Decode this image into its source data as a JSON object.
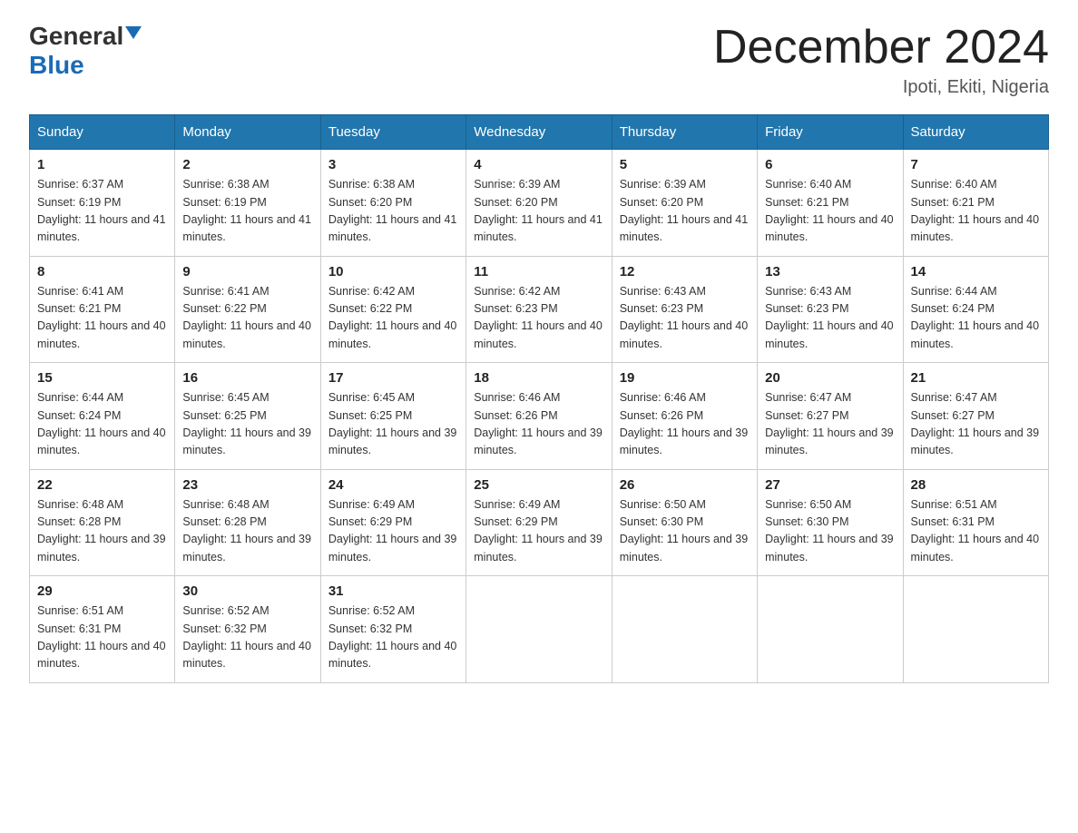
{
  "header": {
    "logo_general": "General",
    "logo_blue": "Blue",
    "month_title": "December 2024",
    "location": "Ipoti, Ekiti, Nigeria"
  },
  "days_of_week": [
    "Sunday",
    "Monday",
    "Tuesday",
    "Wednesday",
    "Thursday",
    "Friday",
    "Saturday"
  ],
  "weeks": [
    [
      {
        "day": "1",
        "sunrise": "6:37 AM",
        "sunset": "6:19 PM",
        "daylight": "11 hours and 41 minutes."
      },
      {
        "day": "2",
        "sunrise": "6:38 AM",
        "sunset": "6:19 PM",
        "daylight": "11 hours and 41 minutes."
      },
      {
        "day": "3",
        "sunrise": "6:38 AM",
        "sunset": "6:20 PM",
        "daylight": "11 hours and 41 minutes."
      },
      {
        "day": "4",
        "sunrise": "6:39 AM",
        "sunset": "6:20 PM",
        "daylight": "11 hours and 41 minutes."
      },
      {
        "day": "5",
        "sunrise": "6:39 AM",
        "sunset": "6:20 PM",
        "daylight": "11 hours and 41 minutes."
      },
      {
        "day": "6",
        "sunrise": "6:40 AM",
        "sunset": "6:21 PM",
        "daylight": "11 hours and 40 minutes."
      },
      {
        "day": "7",
        "sunrise": "6:40 AM",
        "sunset": "6:21 PM",
        "daylight": "11 hours and 40 minutes."
      }
    ],
    [
      {
        "day": "8",
        "sunrise": "6:41 AM",
        "sunset": "6:21 PM",
        "daylight": "11 hours and 40 minutes."
      },
      {
        "day": "9",
        "sunrise": "6:41 AM",
        "sunset": "6:22 PM",
        "daylight": "11 hours and 40 minutes."
      },
      {
        "day": "10",
        "sunrise": "6:42 AM",
        "sunset": "6:22 PM",
        "daylight": "11 hours and 40 minutes."
      },
      {
        "day": "11",
        "sunrise": "6:42 AM",
        "sunset": "6:23 PM",
        "daylight": "11 hours and 40 minutes."
      },
      {
        "day": "12",
        "sunrise": "6:43 AM",
        "sunset": "6:23 PM",
        "daylight": "11 hours and 40 minutes."
      },
      {
        "day": "13",
        "sunrise": "6:43 AM",
        "sunset": "6:23 PM",
        "daylight": "11 hours and 40 minutes."
      },
      {
        "day": "14",
        "sunrise": "6:44 AM",
        "sunset": "6:24 PM",
        "daylight": "11 hours and 40 minutes."
      }
    ],
    [
      {
        "day": "15",
        "sunrise": "6:44 AM",
        "sunset": "6:24 PM",
        "daylight": "11 hours and 40 minutes."
      },
      {
        "day": "16",
        "sunrise": "6:45 AM",
        "sunset": "6:25 PM",
        "daylight": "11 hours and 39 minutes."
      },
      {
        "day": "17",
        "sunrise": "6:45 AM",
        "sunset": "6:25 PM",
        "daylight": "11 hours and 39 minutes."
      },
      {
        "day": "18",
        "sunrise": "6:46 AM",
        "sunset": "6:26 PM",
        "daylight": "11 hours and 39 minutes."
      },
      {
        "day": "19",
        "sunrise": "6:46 AM",
        "sunset": "6:26 PM",
        "daylight": "11 hours and 39 minutes."
      },
      {
        "day": "20",
        "sunrise": "6:47 AM",
        "sunset": "6:27 PM",
        "daylight": "11 hours and 39 minutes."
      },
      {
        "day": "21",
        "sunrise": "6:47 AM",
        "sunset": "6:27 PM",
        "daylight": "11 hours and 39 minutes."
      }
    ],
    [
      {
        "day": "22",
        "sunrise": "6:48 AM",
        "sunset": "6:28 PM",
        "daylight": "11 hours and 39 minutes."
      },
      {
        "day": "23",
        "sunrise": "6:48 AM",
        "sunset": "6:28 PM",
        "daylight": "11 hours and 39 minutes."
      },
      {
        "day": "24",
        "sunrise": "6:49 AM",
        "sunset": "6:29 PM",
        "daylight": "11 hours and 39 minutes."
      },
      {
        "day": "25",
        "sunrise": "6:49 AM",
        "sunset": "6:29 PM",
        "daylight": "11 hours and 39 minutes."
      },
      {
        "day": "26",
        "sunrise": "6:50 AM",
        "sunset": "6:30 PM",
        "daylight": "11 hours and 39 minutes."
      },
      {
        "day": "27",
        "sunrise": "6:50 AM",
        "sunset": "6:30 PM",
        "daylight": "11 hours and 39 minutes."
      },
      {
        "day": "28",
        "sunrise": "6:51 AM",
        "sunset": "6:31 PM",
        "daylight": "11 hours and 40 minutes."
      }
    ],
    [
      {
        "day": "29",
        "sunrise": "6:51 AM",
        "sunset": "6:31 PM",
        "daylight": "11 hours and 40 minutes."
      },
      {
        "day": "30",
        "sunrise": "6:52 AM",
        "sunset": "6:32 PM",
        "daylight": "11 hours and 40 minutes."
      },
      {
        "day": "31",
        "sunrise": "6:52 AM",
        "sunset": "6:32 PM",
        "daylight": "11 hours and 40 minutes."
      },
      {
        "day": "",
        "sunrise": "",
        "sunset": "",
        "daylight": ""
      },
      {
        "day": "",
        "sunrise": "",
        "sunset": "",
        "daylight": ""
      },
      {
        "day": "",
        "sunrise": "",
        "sunset": "",
        "daylight": ""
      },
      {
        "day": "",
        "sunrise": "",
        "sunset": "",
        "daylight": ""
      }
    ]
  ],
  "labels": {
    "sunrise_prefix": "Sunrise: ",
    "sunset_prefix": "Sunset: ",
    "daylight_prefix": "Daylight: "
  }
}
